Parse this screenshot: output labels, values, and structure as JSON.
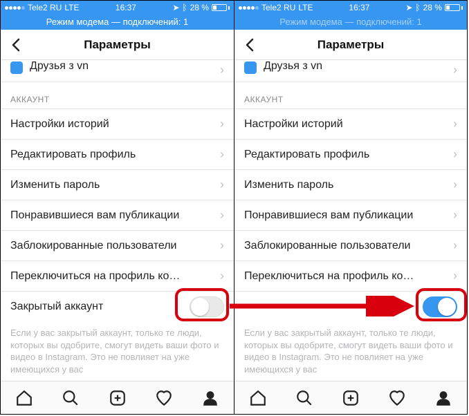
{
  "status": {
    "carrier": "Tele2 RU",
    "network": "LTE",
    "time": "16:37",
    "battery_pct": "28 %",
    "bt_glyph": "⚡",
    "arrow_glyph": "↥"
  },
  "hotspot": "Режим модема — подключений: 1",
  "nav": {
    "title": "Параметры"
  },
  "truncated_prev": "Друзья з vn",
  "section_account": "АККАУНТ",
  "rows": {
    "story": "Настройки историй",
    "edit": "Редактировать профиль",
    "pwd": "Изменить пароль",
    "liked": "Понравившиеся вам публикации",
    "blocked": "Заблокированные пользователи",
    "switch": "Переключиться на профиль ко…",
    "private": "Закрытый аккаунт"
  },
  "helper": "Если у вас закрытый аккаунт, только те люди, которых вы одобрите, смогут видеть ваши фото и видео в Instagram. Это не повлияет на уже имеющихся у вас"
}
